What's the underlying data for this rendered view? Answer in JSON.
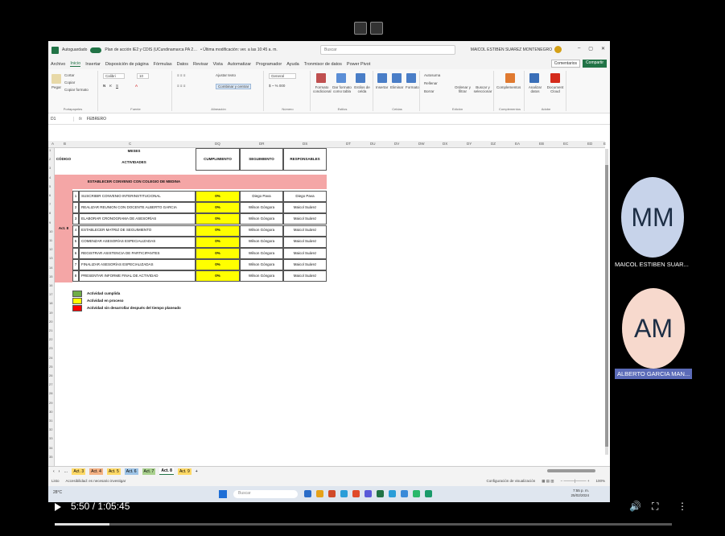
{
  "excel": {
    "titlebar": {
      "autosave": "Autoguardado",
      "filename": "Plan de acción IE2 y CDIS (UCundinamarca PA 2…",
      "last_modified": "• Última modificación: ver. a las 10:45 a. m.",
      "search": "Buscar",
      "user": "MAICOL ESTIBEN SUAREZ MONTENEGRO",
      "min": "–",
      "restore": "▢",
      "close": "✕"
    },
    "menu": [
      "Archivo",
      "Inicio",
      "Insertar",
      "Disposición de página",
      "Fórmulas",
      "Datos",
      "Revisar",
      "Vista",
      "Automatizar",
      "Programador",
      "Ayuda",
      "Tronmisor de datos",
      "Power Pivot"
    ],
    "menu_active": "Inicio",
    "comments": "Comentarios",
    "share": "Compartir",
    "ribbon_groups": [
      "Portapapeles",
      "Fuente",
      "Alineación",
      "Número",
      "Estilos",
      "Celdas",
      "Edición",
      "Complementos",
      "Adobe"
    ],
    "ribbon_labels": {
      "paste": "Pegar",
      "cut": "Cortar",
      "copy": "Copiar",
      "format_painter": "Copiar formato",
      "font": "Calibri",
      "size": "10",
      "wrap": "Ajustar texto",
      "merge": "Combinar y centrar",
      "number_format": "General",
      "cond_format": "Formato condicional",
      "table_format": "Dar formato como tabla",
      "cell_styles": "Estilos de celda",
      "insert": "Insertar",
      "delete": "Eliminar",
      "format": "Formato",
      "autosum": "Autosuma",
      "fill": "Rellenar",
      "clear": "Borrar",
      "sort": "Ordenar y filtrar",
      "find": "Buscar y seleccionar",
      "addins": "Complementos",
      "analyze": "Analizar datos",
      "document": "Document Cloud"
    },
    "namebox": "D1",
    "formula": "FEBRERO",
    "columns": [
      "A",
      "B",
      "C",
      "DQ",
      "DR",
      "DS",
      "DT",
      "DU",
      "DV",
      "DW",
      "DX",
      "DY",
      "DZ",
      "EA",
      "EB",
      "EC",
      "ED",
      "E"
    ],
    "rows": [
      "1",
      "2",
      "3",
      "4",
      "5",
      "6",
      "7",
      "8",
      "9",
      "10",
      "11",
      "12",
      "13",
      "14",
      "15",
      "16",
      "17",
      "18",
      "19",
      "20",
      "21",
      "22",
      "23",
      "24",
      "25",
      "26",
      "27",
      "28",
      "29",
      "30",
      "31",
      "32",
      "33",
      "34",
      "35"
    ],
    "table": {
      "codigo_header": "CÓDIGO",
      "meses_header": "MESES",
      "actividades_header": "ACTIVIDADES",
      "cumplimiento_header": "CUMPLIMIENTO",
      "seguimiento_header": "SEGUIMIENTO",
      "responsables_header": "RESPONSABLES",
      "section_title": "ESTABLECER CONVENIO CON COLEGIO DE MEDINA",
      "code": "Act. 8",
      "rows": [
        {
          "n": "1",
          "activity": "SUSCRIBIR CONVENIO INTERINSTITUCIONAL",
          "pct": "0%",
          "seg": "Diego Pava",
          "resp": "Diego Pava"
        },
        {
          "n": "2",
          "activity": "REALIZAR REUNION CON DOCENTE ALBERTO GARCIA",
          "pct": "0%",
          "seg": "Wilson Góngora",
          "resp": "Maicol Suárez"
        },
        {
          "n": "3",
          "activity": "ELABORAR CRONOGRAMA DE ASESORÍAS",
          "pct": "0%",
          "seg": "Wilson Góngora",
          "resp": "Maicol Suárez"
        },
        {
          "n": "4",
          "activity": "ESTABLECER MATRIZ DE SEGUIMIENTO",
          "pct": "0%",
          "seg": "Wilson Góngora",
          "resp": "Maicol Suárez"
        },
        {
          "n": "5",
          "activity": "COMENZAR ASESORÍAS ESPECIALIZADAS",
          "pct": "0%",
          "seg": "Wilson Góngora",
          "resp": "Maicol Suárez"
        },
        {
          "n": "6",
          "activity": "REGISTRAR ASISTENCIA DE PARTICIPANTES",
          "pct": "0%",
          "seg": "Wilson Góngora",
          "resp": "Maicol Suárez"
        },
        {
          "n": "7",
          "activity": "FINALIZAR ASESORÍAS ESPECIALIZADAS",
          "pct": "0%",
          "seg": "Wilson Góngora",
          "resp": "Maicol Suárez"
        },
        {
          "n": "8",
          "activity": "PRESENTAR INFORME FINAL DE ACTIVIDAD",
          "pct": "0%",
          "seg": "Wilson Góngora",
          "resp": "Maicol Suárez"
        }
      ]
    },
    "legend": {
      "green": "Actividad cumplida",
      "yellow": "Actividad en proceso",
      "red": "Actividad sin desarrollar después del tiempo planeado"
    },
    "sheet_tabs": [
      "Act. 3",
      "Act. 4",
      "Act. 5",
      "Act. 6",
      "Act. 7",
      "Act. 8",
      "Act. 9"
    ],
    "sheet_add": "+",
    "active_sheet": "Act. 8",
    "status": {
      "ready": "Listo",
      "accessibility": "Accesibilidad: es necesario investigar",
      "display": "Configuración de visualización",
      "zoom": "100%"
    }
  },
  "taskbar": {
    "weather": "28°C",
    "search": "Buscar",
    "time": "7:55 p. m.",
    "date": "25/02/2024"
  },
  "participants": [
    {
      "initials": "MM",
      "name": "MAICOL ESTIBEN SUAR...",
      "color": "#c7d3ea"
    },
    {
      "initials": "AM",
      "name": "ALBERTO GARCIA MAN...",
      "color": "#f7d9cd"
    }
  ],
  "player": {
    "time": "5:50 / 1:05:45",
    "progress": 0.089
  }
}
